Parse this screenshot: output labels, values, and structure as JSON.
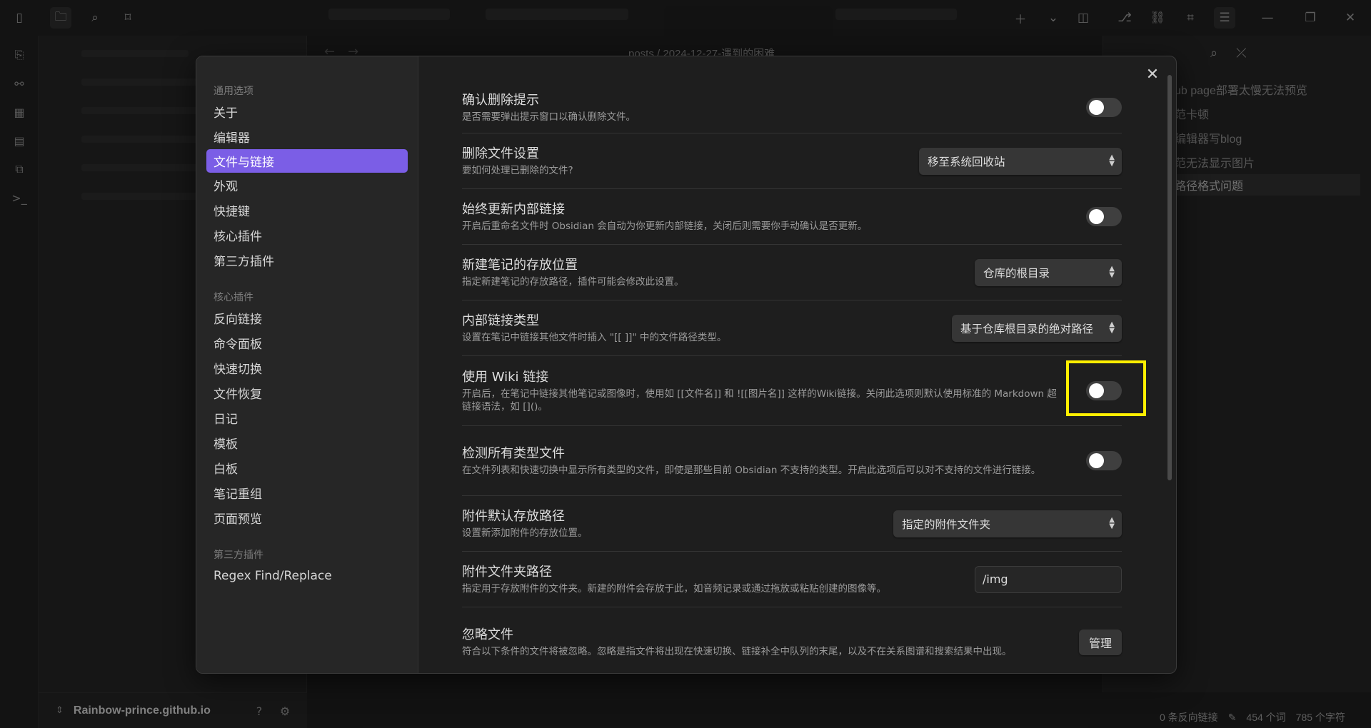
{
  "modal": {
    "close_label": "✕",
    "sidebar": {
      "sections": [
        {
          "title": "通用选项",
          "items": [
            "关于",
            "编辑器",
            "文件与链接",
            "外观",
            "快捷键",
            "核心插件",
            "第三方插件"
          ]
        },
        {
          "title": "核心插件",
          "items": [
            "反向链接",
            "命令面板",
            "快速切换",
            "文件恢复",
            "日记",
            "模板",
            "白板",
            "笔记重组",
            "页面预览"
          ]
        },
        {
          "title": "第三方插件",
          "items": [
            "Regex Find/Replace"
          ]
        }
      ],
      "active_item": "文件与链接"
    },
    "settings": [
      {
        "name": "确认删除提示",
        "desc": "是否需要弹出提示窗口以确认删除文件。",
        "control": "toggle",
        "state": false
      },
      {
        "name": "删除文件设置",
        "desc": "要如何处理已删除的文件?",
        "control": "select",
        "value": "移至系统回收站"
      },
      {
        "name": "始终更新内部链接",
        "desc": "开启后重命名文件时 Obsidian 会自动为你更新内部链接，关闭后则需要你手动确认是否更新。",
        "control": "toggle",
        "state": false
      },
      {
        "name": "新建笔记的存放位置",
        "desc": "指定新建笔记的存放路径，插件可能会修改此设置。",
        "control": "select",
        "value": "仓库的根目录"
      },
      {
        "name": "内部链接类型",
        "desc": "设置在笔记中链接其他文件时插入 \"[[ ]]\" 中的文件路径类型。",
        "control": "select",
        "value": "基于仓库根目录的绝对路径"
      },
      {
        "name": "使用 Wiki 链接",
        "desc": "开启后，在笔记中链接其他笔记或图像时，使用如 [[文件名]] 和 ![[图片名]] 这样的Wiki链接。关闭此选项则默认使用标准的 Markdown 超链接语法，如 []()。",
        "control": "toggle",
        "state": false,
        "highlighted": true
      },
      {
        "name": "检测所有类型文件",
        "desc": "在文件列表和快速切换中显示所有类型的文件，即使是那些目前 Obsidian 不支持的类型。开启此选项后可以对不支持的文件进行链接。",
        "control": "toggle",
        "state": false
      },
      {
        "name": "附件默认存放路径",
        "desc": "设置新添加附件的存放位置。",
        "control": "select",
        "value": "指定的附件文件夹"
      },
      {
        "name": "附件文件夹路径",
        "desc": "指定用于存放附件的文件夹。新建的附件会存放于此，如音频记录或通过拖放或粘贴创建的图像等。",
        "control": "input",
        "value": "/img"
      },
      {
        "name": "忽略文件",
        "desc": "符合以下条件的文件将被忽略。忽略是指文件将出现在快速切换、链接补全中队列的末尾，以及不在关系图谱和搜索结果中出现。",
        "control": "button",
        "value": "管理"
      }
    ]
  },
  "background": {
    "breadcrumb": "posts / 2024-12-27-遇到的困难",
    "outline_items": [
      "ub page部署太慢无法预览",
      "范卡顿",
      "编辑器写blog",
      "范无法显示图片",
      "路径格式问题"
    ],
    "vault_name": "Rainbow-prince.github.io",
    "status": {
      "backlinks": "0 条反向链接",
      "words": "454 个词",
      "chars": "785 个字符"
    }
  },
  "colors": {
    "accent": "#7b5ee6",
    "highlight": "#ffee00"
  }
}
